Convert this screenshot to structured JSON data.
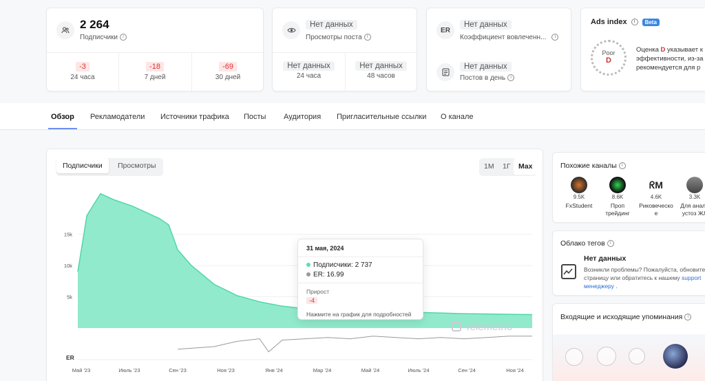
{
  "stats": {
    "subscribers": {
      "value": "2 264",
      "label": "Подписчики",
      "icon": "users-icon",
      "changes": [
        {
          "delta": "-3",
          "period": "24 часа"
        },
        {
          "delta": "-18",
          "period": "7 дней"
        },
        {
          "delta": "-69",
          "period": "30 дней"
        }
      ]
    },
    "views": {
      "value": "Нет данных",
      "label": "Просмотры поста",
      "icon": "eye-icon",
      "changes": [
        {
          "value": "Нет данных",
          "period": "24 часа"
        },
        {
          "value": "Нет данных",
          "period": "48 часов"
        }
      ]
    },
    "er": {
      "icon_text": "ER",
      "value": "Нет данных",
      "label": "Коэффициент вовлеченн...",
      "posts_value": "Нет данных",
      "posts_label": "Постов в день"
    },
    "ads": {
      "title": "Ads index",
      "badge": "Beta",
      "grade_word": "Poor",
      "grade": "D",
      "desc_prefix": "Оценка ",
      "desc_grade": "D",
      "desc_line1": " указывает к",
      "desc_line2": "эффективности, из-за",
      "desc_line3": "рекомендуется для р"
    }
  },
  "tabs": [
    "Обзор",
    "Рекламодатели",
    "Источники трафика",
    "Посты",
    "Аудитория",
    "Пригласительные ссылки",
    "О канале"
  ],
  "chart_panel": {
    "toggle": [
      "Подписчики",
      "Просмотры"
    ],
    "ranges": [
      "1M",
      "1Г",
      "Max"
    ],
    "tooltip": {
      "date": "31 мая, 2024",
      "subs_label": "Подписчики: ",
      "subs_value": "2 737",
      "er_label": "ER: ",
      "er_value": "16.99",
      "growth_label": "Прирост",
      "growth_value": "-4",
      "hint": "Нажмите на график для подробностей"
    },
    "watermark": "Telemetrio",
    "er_axis_label": "ER"
  },
  "chart_data": {
    "type": "area",
    "y_ticks": [
      "15k",
      "10k",
      "5k"
    ],
    "ylim": [
      0,
      22000
    ],
    "x_ticks": [
      "Май '23",
      "Июль '23",
      "Сен '23",
      "Ноя '23",
      "Янв '24",
      "Мар '24",
      "Май '24",
      "Июль '24",
      "Сен '24",
      "Ноя '24"
    ],
    "series": [
      {
        "name": "Подписчики",
        "x": [
          0,
          0.02,
          0.05,
          0.08,
          0.12,
          0.15,
          0.18,
          0.2,
          0.22,
          0.25,
          0.3,
          0.35,
          0.4,
          0.45,
          0.5,
          0.55,
          0.6,
          0.65,
          0.7,
          0.75,
          0.8,
          0.85,
          0.9,
          0.95,
          1
        ],
        "values": [
          9000,
          18000,
          21500,
          20500,
          19500,
          18500,
          17500,
          16500,
          12500,
          10000,
          7000,
          5200,
          4200,
          3500,
          3100,
          2900,
          2800,
          2700,
          2600,
          2500,
          2400,
          2300,
          2250,
          2200,
          2150
        ]
      }
    ],
    "er_series": {
      "name": "ER",
      "x": [
        0.22,
        0.3,
        0.35,
        0.4,
        0.42,
        0.45,
        0.5,
        0.55,
        0.6,
        0.65,
        0.7,
        0.75,
        0.8,
        0.85,
        0.9,
        0.95,
        1
      ],
      "values": [
        8,
        10,
        14,
        16,
        6,
        15,
        16,
        17,
        16,
        18,
        17,
        16,
        17,
        16,
        17,
        18,
        18
      ]
    }
  },
  "similar": {
    "title": "Похожие каналы",
    "channels": [
      {
        "count": "9.5K",
        "name": "FxStudent"
      },
      {
        "count": "8.6K",
        "name": "Проп трейдинг"
      },
      {
        "count": "4.6K",
        "name": "Риковеческо е"
      },
      {
        "count": "3.3K",
        "name": "Для анали устоз ЖЛ"
      }
    ]
  },
  "tags": {
    "title": "Облако тегов",
    "nodata": "Нет данных",
    "text1": "Возникли проблемы? Пожалуйста, обновите",
    "text2": "страницу или обратитесь к нашему ",
    "link": "support",
    "link2": "менеджеру",
    "tail": " ."
  },
  "mentions": {
    "title": "Входящие и исходящие упоминания"
  }
}
